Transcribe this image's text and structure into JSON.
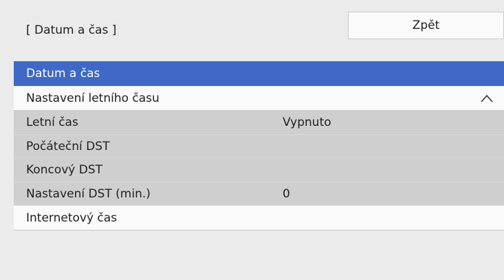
{
  "header": {
    "title": "[ Datum a čas ]",
    "back_label": "Zpět"
  },
  "menu": {
    "items": [
      {
        "label": "Datum a čas",
        "state": "selected"
      },
      {
        "label": "Nastavení letního času",
        "state": "expanded",
        "icon": "chevron-up-icon"
      },
      {
        "label": "Letní čas",
        "value": "Vypnuto"
      },
      {
        "label": "Počáteční DST"
      },
      {
        "label": "Koncový DST"
      },
      {
        "label": "Nastavení DST (min.)",
        "value": "0"
      },
      {
        "label": "Internetový čas"
      }
    ]
  },
  "colors": {
    "selected_bg": "#3f68c7",
    "sub_bg": "#cfcfcf",
    "page_bg": "#ebebeb"
  }
}
